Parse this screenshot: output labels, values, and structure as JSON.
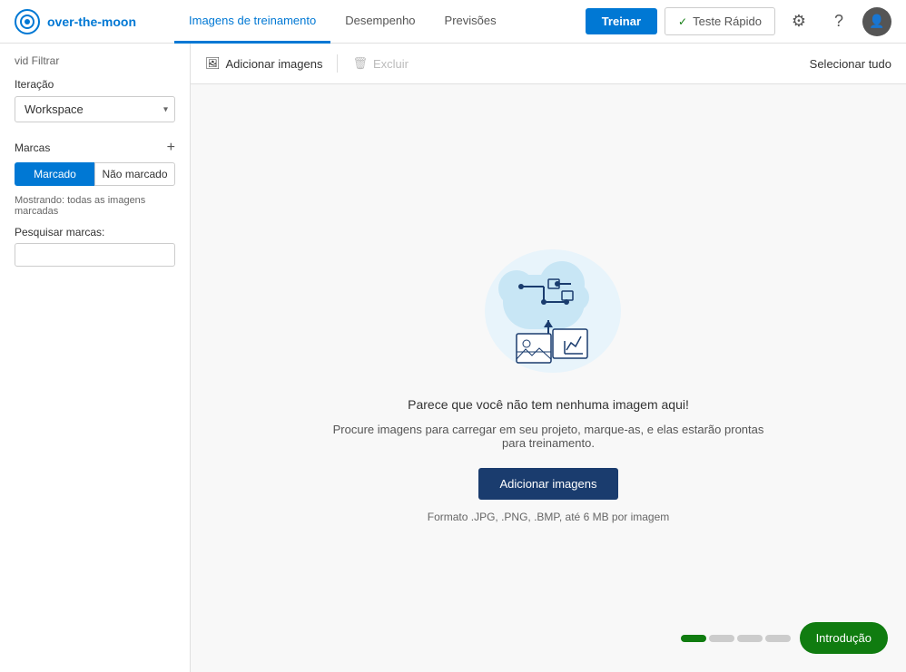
{
  "header": {
    "logo_text": "over-the-moon",
    "nav_tabs": [
      {
        "label": "Imagens de treinamento",
        "active": true
      },
      {
        "label": "Desempenho",
        "active": false
      },
      {
        "label": "Previsões",
        "active": false
      }
    ],
    "btn_train": "Treinar",
    "btn_quick_test": "Teste Rápido"
  },
  "sidebar": {
    "filter_label": "vid Filtrar",
    "iteration_label": "Iteração",
    "iteration_options": [
      "Workspace"
    ],
    "iteration_selected": "Workspace",
    "tags_label": "Marcas",
    "tag_buttons": [
      {
        "label": "Marcado",
        "active": true
      },
      {
        "label": "Não marcado",
        "active": false
      }
    ],
    "showing_label": "Mostrando: todas as imagens marcadas",
    "search_label": "Pesquisar marcas:"
  },
  "toolbar": {
    "add_images_label": "Adicionar imagens",
    "delete_label": "Excluir",
    "select_all_label": "Selecionar tudo"
  },
  "empty_state": {
    "title": "Parece que você não tem nenhuma imagem aqui!",
    "subtitle": "Procure imagens para carregar em seu projeto, marque-as, e elas estarão prontas para treinamento.",
    "btn_add_label": "Adicionar imagens",
    "format_note": "Formato .JPG, .PNG, .BMP, até 6 MB por imagem"
  },
  "bottom": {
    "intro_label": "Introdução",
    "dots": [
      {
        "active": true
      },
      {
        "active": false
      },
      {
        "active": false
      },
      {
        "active": false
      }
    ]
  }
}
